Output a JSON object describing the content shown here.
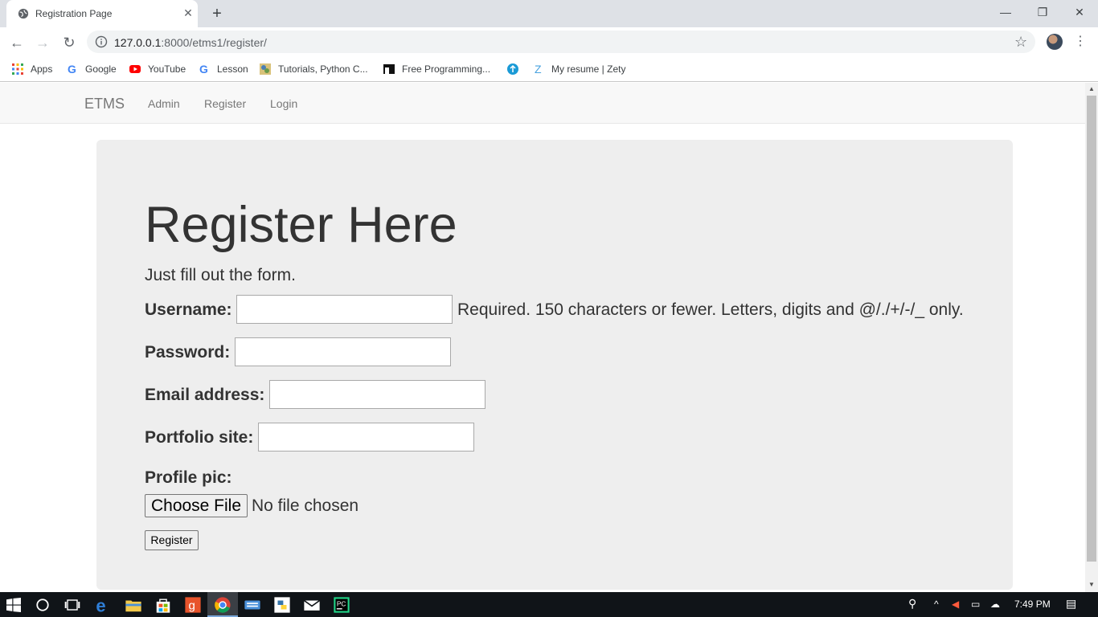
{
  "browser": {
    "tab_title": "Registration Page",
    "tab_close": "✕",
    "new_tab": "+",
    "window_controls": {
      "minimize": "—",
      "restore": "❐",
      "close": "✕"
    },
    "url_host": "127.0.0.1",
    "url_rest": ":8000/etms1/register/",
    "bookmarks": [
      {
        "label": "Apps",
        "icon": "apps-grid-icon"
      },
      {
        "label": "Google",
        "icon": "google-icon"
      },
      {
        "label": "YouTube",
        "icon": "youtube-icon"
      },
      {
        "label": "Lesson",
        "icon": "google-icon"
      },
      {
        "label": "Tutorials, Python C...",
        "icon": "tutorials-icon"
      },
      {
        "label": "Free Programming...",
        "icon": "free-programming-icon"
      },
      {
        "label": "",
        "icon": "blue-circle-icon"
      },
      {
        "label": "My resume | Zety",
        "icon": "zety-icon"
      }
    ]
  },
  "navbar": {
    "brand": "ETMS",
    "links": [
      "Admin",
      "Register",
      "Login"
    ]
  },
  "page": {
    "heading": "Register Here",
    "lead": "Just fill out the form.",
    "fields": {
      "username_label": "Username:",
      "username_value": "",
      "username_help": "Required. 150 characters or fewer. Letters, digits and @/./+/-/_ only.",
      "password_label": "Password:",
      "password_value": "",
      "email_label": "Email address:",
      "email_value": "",
      "portfolio_label": "Portfolio site:",
      "portfolio_value": "",
      "profile_pic_label": "Profile pic:",
      "choose_file": "Choose File",
      "file_status": "No file chosen"
    },
    "submit_label": "Register"
  },
  "taskbar": {
    "time": "7:49 PM"
  },
  "colors": {
    "jumbotron": "#eeeeee",
    "navbar": "#f8f8f8",
    "taskbar": "#101418"
  }
}
